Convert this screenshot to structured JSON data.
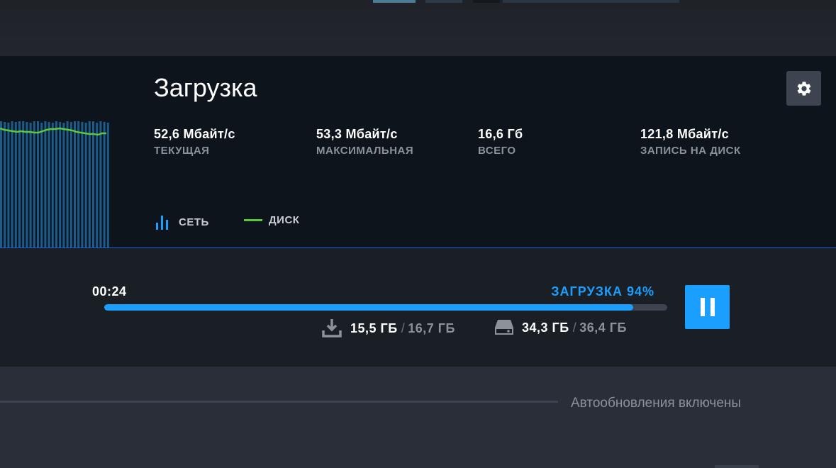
{
  "colors": {
    "accent": "#1a9fff",
    "network_bar": "#1c5b8c",
    "disk_line": "#5ac93a",
    "panel_bg": "#0e141b"
  },
  "stats_panel": {
    "title": "Загрузка",
    "settings_icon": "gear-icon",
    "stats": [
      {
        "value": "52,6 Мбайт/с",
        "label": "ТЕКУЩАЯ"
      },
      {
        "value": "53,3 Мбайт/с",
        "label": "МАКСИМАЛЬНАЯ"
      },
      {
        "value": "16,6 Гб",
        "label": "ВСЕГО"
      },
      {
        "value": "121,8 Мбайт/с",
        "label": "ЗАПИСЬ НА ДИСК"
      }
    ],
    "legend": {
      "network": "СЕТЬ",
      "disk": "ДИСК"
    }
  },
  "progress": {
    "time_remaining": "00:24",
    "status": "ЗАГРУЗКА 94%",
    "percent": 94,
    "download": {
      "current": "15,5 ГБ",
      "separator": "/",
      "total": "16,7 ГБ",
      "icon": "download-icon"
    },
    "disk": {
      "current": "34,3 ГБ",
      "separator": "/",
      "total": "36,4 ГБ",
      "icon": "hard-drive-icon"
    },
    "pause_icon": "pause-icon"
  },
  "footer": {
    "auto_updates": "Автообновления включены"
  }
}
